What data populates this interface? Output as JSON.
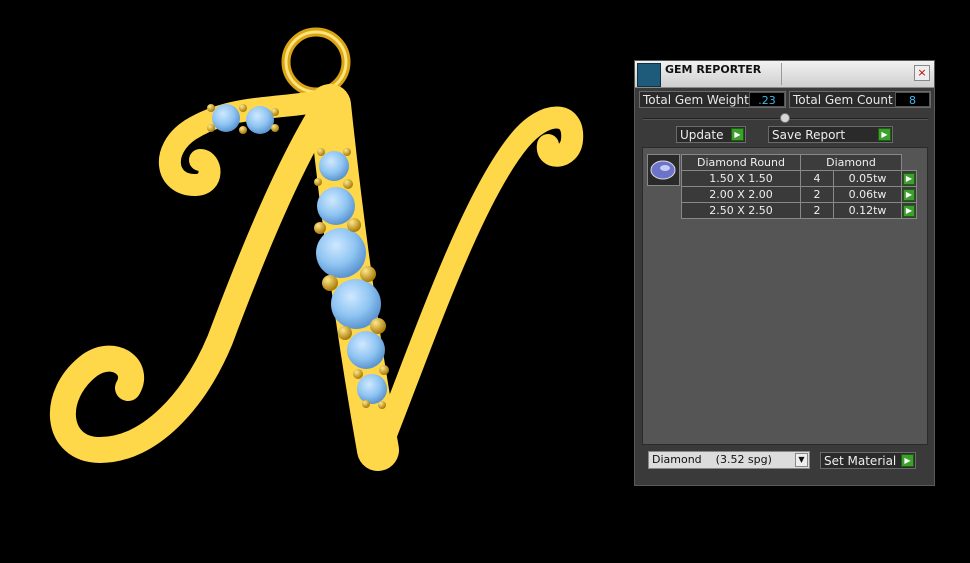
{
  "panel": {
    "title": "GEM REPORTER",
    "close_label": "×",
    "total_gem_weight_label": "Total Gem Weight",
    "total_gem_weight_value": ".23",
    "total_gem_count_label": "Total Gem Count",
    "total_gem_count_value": "8",
    "update_label": "Update",
    "save_report_label": "Save Report",
    "go_glyph": "▶",
    "table": {
      "headers": [
        "Diamond Round",
        "Diamond"
      ],
      "rows": [
        {
          "size": "1.50 X 1.50",
          "count": "4",
          "weight": "0.05tw"
        },
        {
          "size": "2.00 X 2.00",
          "count": "2",
          "weight": "0.06tw"
        },
        {
          "size": "2.50 X 2.50",
          "count": "2",
          "weight": "0.12tw"
        }
      ]
    },
    "material_select_value": "Diamond    (3.52 spg)",
    "material_arrow": "▼",
    "set_material_label": "Set Material"
  },
  "viewport": {
    "model": "letter-N-pendant",
    "metal_color": "#FFD84A",
    "gem_color": "#8EC4F2",
    "background_color": "#000000"
  }
}
